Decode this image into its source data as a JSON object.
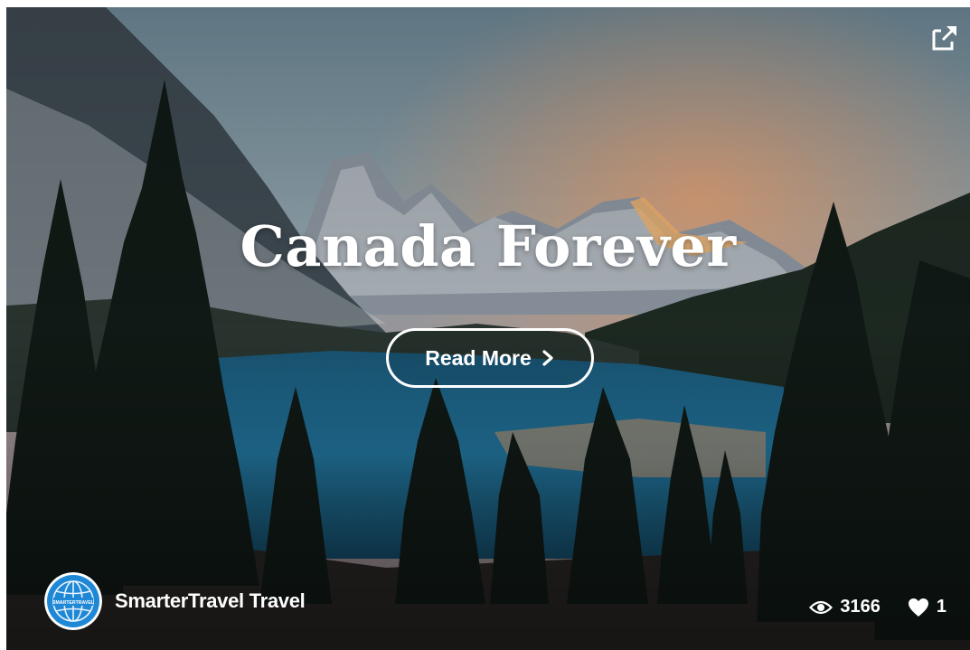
{
  "card": {
    "title": "Canada Forever",
    "read_more_label": "Read More",
    "author_name": "SmarterTravel Travel",
    "avatar_text": "SMARTERTRAVEL",
    "views": "3166",
    "likes": "1",
    "icons": {
      "external": "external-link-icon",
      "read_more": "chevron-right-icon",
      "views": "eye-icon",
      "likes": "heart-icon",
      "avatar": "globe-icon"
    },
    "colors": {
      "text": "#ffffff",
      "avatar_blue": "#1e88d6",
      "lake": "#1f6f96"
    }
  }
}
